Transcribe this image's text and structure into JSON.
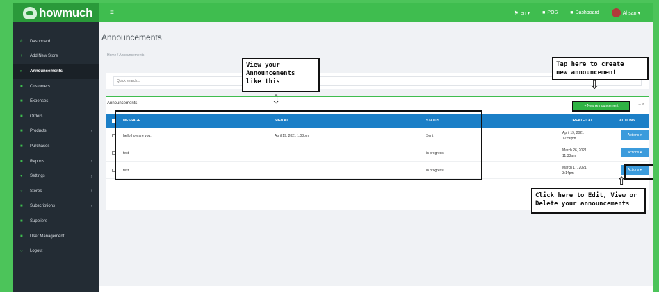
{
  "topbar": {
    "logo": "howmuch",
    "menu_icon": "hamburger-icon",
    "lang": "en ▾",
    "pos": "POS",
    "dashboard": "Dashboard",
    "user": "Ahsan ▾"
  },
  "sidebar": {
    "items": [
      {
        "label": "Dashboard",
        "icon": "#",
        "caret": ""
      },
      {
        "label": "Add New Store",
        "icon": "+",
        "caret": ""
      },
      {
        "label": "Announcements",
        "icon": "»",
        "caret": ""
      },
      {
        "label": "Customers",
        "icon": "■",
        "caret": ""
      },
      {
        "label": "Expenses",
        "icon": "■",
        "caret": ""
      },
      {
        "label": "Orders",
        "icon": "■",
        "caret": ""
      },
      {
        "label": "Products",
        "icon": "■",
        "caret": "›"
      },
      {
        "label": "Purchases",
        "icon": "■",
        "caret": ""
      },
      {
        "label": "Reports",
        "icon": "■",
        "caret": "›"
      },
      {
        "label": "Settings",
        "icon": "●",
        "caret": "›"
      },
      {
        "label": "Stores",
        "icon": "○",
        "caret": "›"
      },
      {
        "label": "Subscriptions",
        "icon": "■",
        "caret": "›"
      },
      {
        "label": "Suppliers",
        "icon": "■",
        "caret": ""
      },
      {
        "label": "User Management",
        "icon": "■",
        "caret": ""
      },
      {
        "label": "Logout",
        "icon": "○",
        "caret": ""
      }
    ]
  },
  "page": {
    "title": "Announcements",
    "breadcrumb": "Home / Announcements",
    "search_placeholder": "Quick search..."
  },
  "card": {
    "title": "Announcements",
    "new_button": "+ New Announcement",
    "tools": "– ×",
    "columns": {
      "message": "MESSAGE",
      "sign_at": "SIGN AT",
      "status": "STATUS",
      "created_at": "CREATED AT",
      "actions": "ACTIONS"
    },
    "rows": [
      {
        "message": "hello how are you.",
        "sign_at": "April 19, 2021 1:08pm",
        "status": "Sent",
        "created_1": "April 19, 2021",
        "created_2": "12:56pm",
        "action": "Actions ▾"
      },
      {
        "message": "test",
        "sign_at": "",
        "status": "in progress",
        "created_1": "March 26, 2021",
        "created_2": "11:33am",
        "action": "Actions ▾"
      },
      {
        "message": "test",
        "sign_at": "",
        "status": "in progress",
        "created_1": "March 17, 2021",
        "created_2": "3:14pm",
        "action": "Actions ▾"
      }
    ]
  },
  "annotations": {
    "view": "View your\nAnnouncements\nlike this",
    "create": "Tap here to create\nnew announcement",
    "edit": "Click here to Edit, View or\nDelete your announcements"
  },
  "colors": {
    "green": "#3fbd4f",
    "sidebar": "#232c34",
    "table_header": "#1b7fc7",
    "action_button": "#3b9bdc"
  }
}
